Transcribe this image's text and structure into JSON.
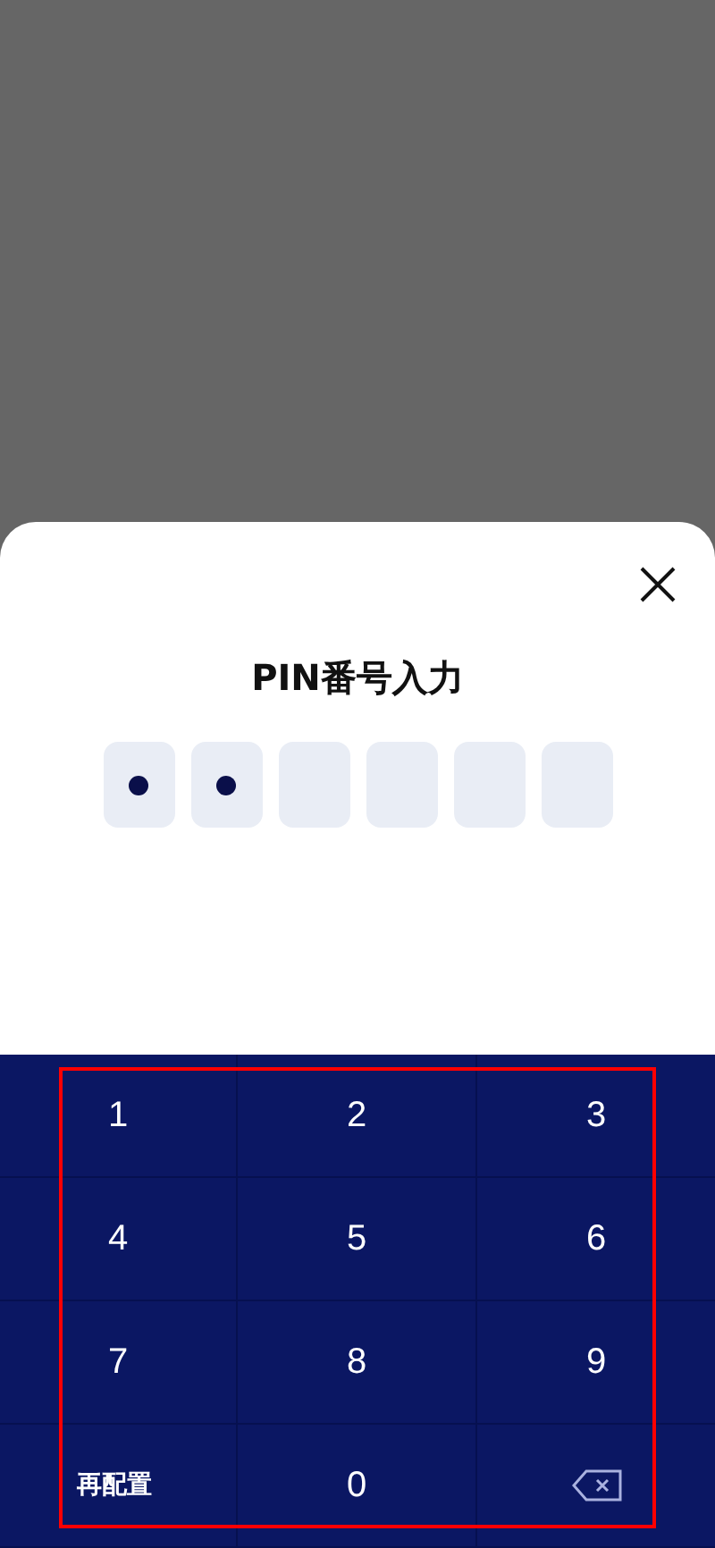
{
  "title": "PIN番号入力",
  "pin_slots": [
    {
      "filled": true
    },
    {
      "filled": true
    },
    {
      "filled": false
    },
    {
      "filled": false
    },
    {
      "filled": false
    },
    {
      "filled": false
    }
  ],
  "keypad": [
    {
      "kind": "digit",
      "label": "1"
    },
    {
      "kind": "digit",
      "label": "2"
    },
    {
      "kind": "digit",
      "label": "3"
    },
    {
      "kind": "digit",
      "label": "4"
    },
    {
      "kind": "digit",
      "label": "5"
    },
    {
      "kind": "digit",
      "label": "6"
    },
    {
      "kind": "digit",
      "label": "7"
    },
    {
      "kind": "digit",
      "label": "8"
    },
    {
      "kind": "digit",
      "label": "9"
    },
    {
      "kind": "text",
      "label": "再配置"
    },
    {
      "kind": "digit",
      "label": "0"
    },
    {
      "kind": "backspace"
    }
  ]
}
